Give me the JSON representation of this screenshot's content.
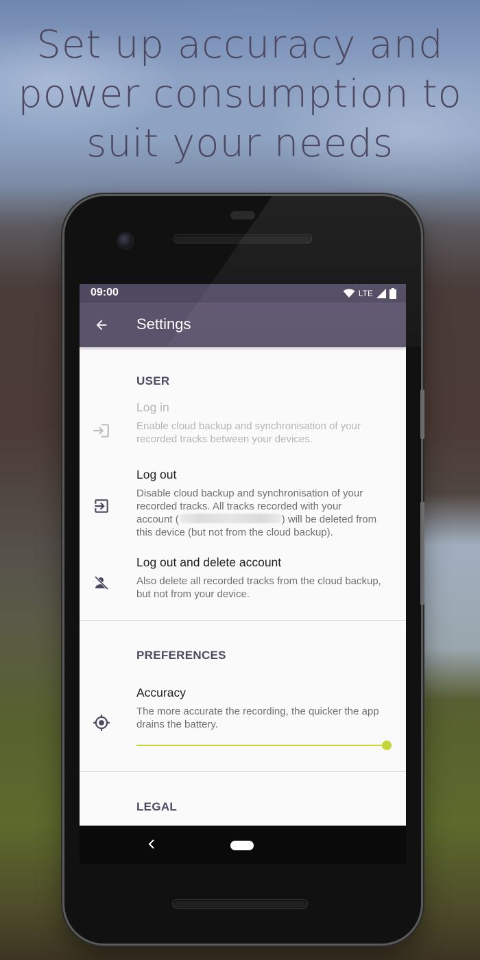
{
  "promo": {
    "headline_lines": [
      "Set up accuracy and",
      "power consumption to",
      "suit your needs"
    ]
  },
  "status_bar": {
    "time": "09:00",
    "network": "LTE",
    "icons": [
      "wifi-icon",
      "cell-signal-icon",
      "battery-icon"
    ]
  },
  "app_bar": {
    "back_icon": "arrow-back-icon",
    "title": "Settings"
  },
  "sections": {
    "user": {
      "header": "USER",
      "login": {
        "icon": "login-icon",
        "title": "Log in",
        "summary": "Enable cloud backup and synchronisation of your recorded tracks between your devices.",
        "enabled": false
      },
      "logout": {
        "icon": "logout-icon",
        "title": "Log out",
        "summary_line1": "Disable cloud backup and synchronisation of your",
        "summary_line2": "recorded tracks. All tracks recorded with your",
        "summary_line3_prefix": "account (",
        "summary_line3_suffix": ") will be deleted from",
        "summary_line4": "this device (but not from the cloud backup)."
      },
      "logout_delete": {
        "icon": "person-off-icon",
        "title": "Log out and delete account",
        "summary": "Also delete all recorded tracks from the cloud backup, but not from your device."
      }
    },
    "preferences": {
      "header": "PREFERENCES",
      "accuracy": {
        "icon": "gps-target-icon",
        "title": "Accuracy",
        "summary": "The more accurate the recording, the quicker the app drains the battery.",
        "slider_value": 1.0
      }
    },
    "legal": {
      "header": "LEGAL"
    }
  },
  "nav_bar": {
    "back_icon": "nav-back-icon",
    "home_icon": "home-pill-icon"
  },
  "colors": {
    "status_bar": "#4e4860",
    "app_bar": "#5a536c",
    "accent": "#c5d63a",
    "section_header": "#4e4860"
  }
}
